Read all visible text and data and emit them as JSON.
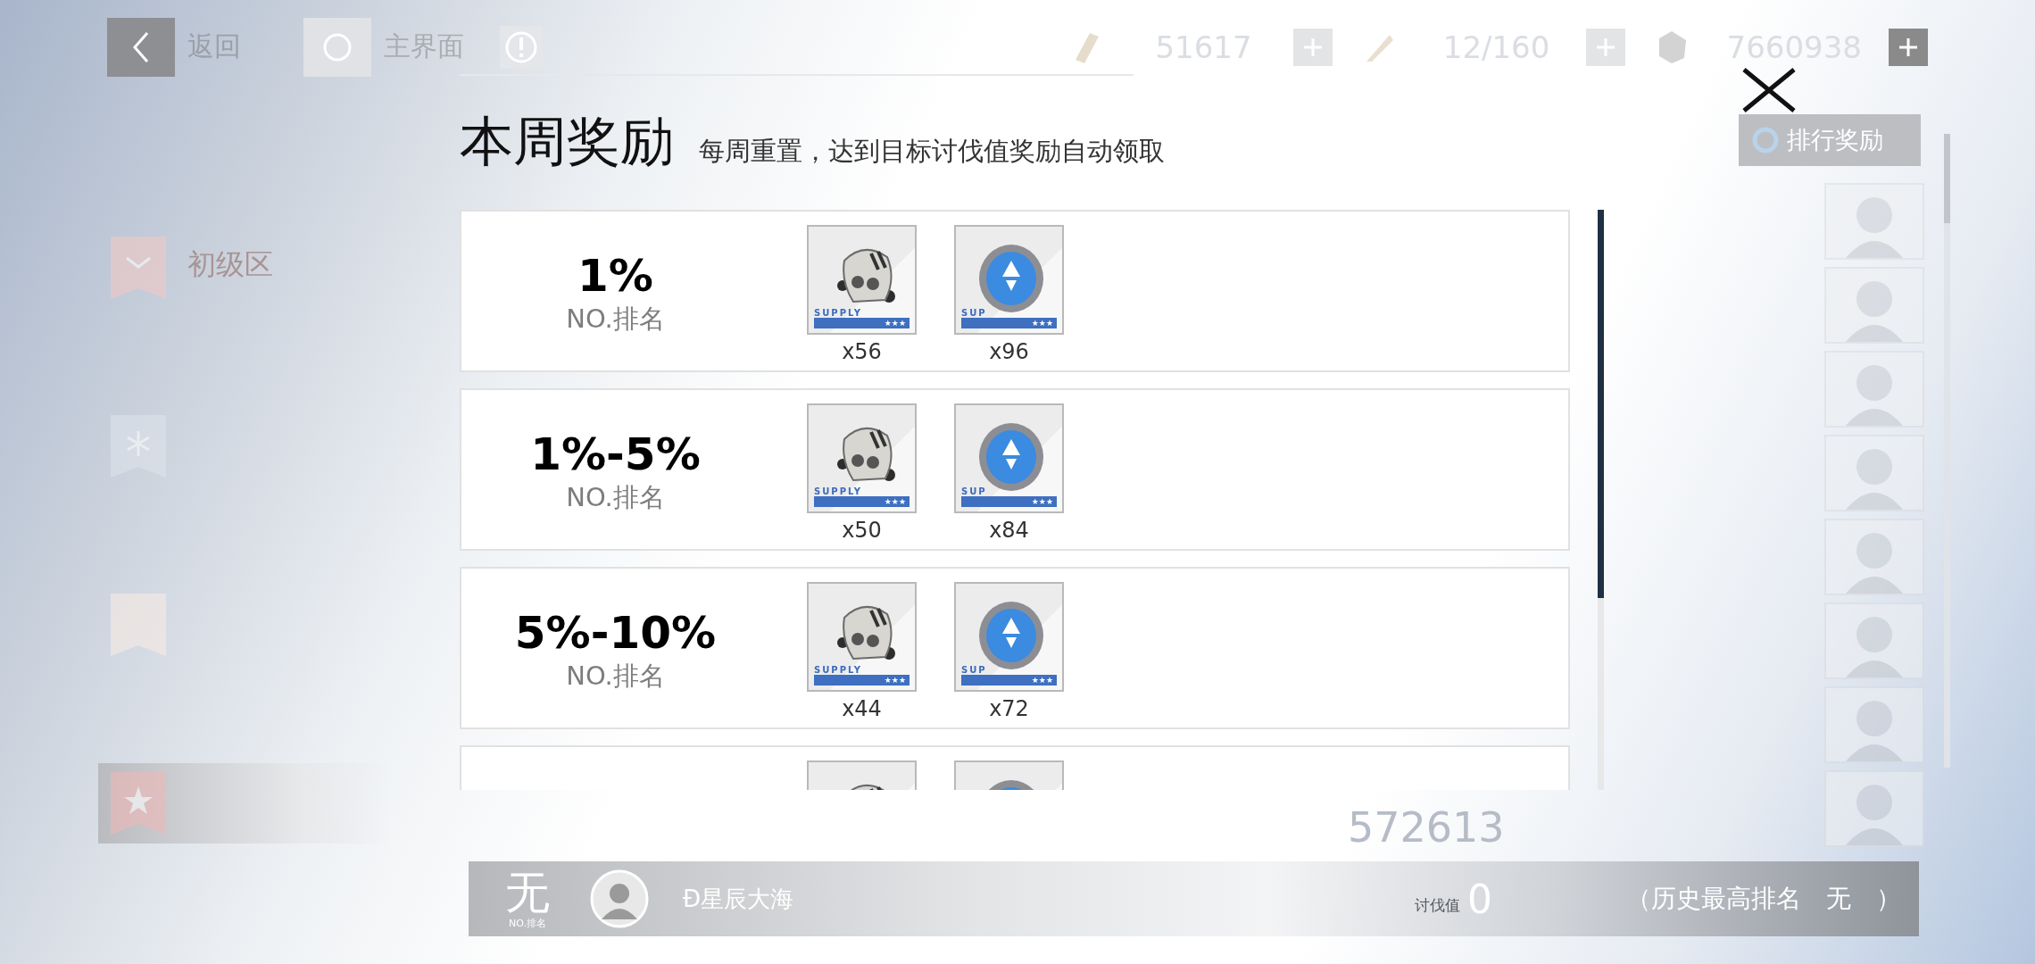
{
  "nav": {
    "back": "返回",
    "home": "主界面"
  },
  "currencies": [
    {
      "amount": "51617",
      "kind": "bar",
      "highlight": false
    },
    {
      "amount": "12/160",
      "kind": "feather",
      "highlight": false
    },
    {
      "amount": "7660938",
      "kind": "coin",
      "highlight": true
    }
  ],
  "sidebar": {
    "items": [
      {
        "kind": "chevron",
        "label": "初级区",
        "selected": false
      },
      {
        "kind": "snowflake",
        "selected": false
      },
      {
        "kind": "blank",
        "selected": false
      },
      {
        "kind": "star",
        "selected": true
      }
    ]
  },
  "background_score": "572613",
  "panel": {
    "title": "本周奖励",
    "subtitle": "每周重置，达到目标讨伐值奖励自动领取",
    "ranking_button": "排行奖励",
    "tiers": [
      {
        "tier": "1%",
        "caption": "NO.排名",
        "items": [
          {
            "kind": "mask",
            "tag": "SUPPLY",
            "rank": "★★★",
            "qty": "x56"
          },
          {
            "kind": "disc",
            "tag": "SUP",
            "rank": "★★★",
            "qty": "x96"
          }
        ]
      },
      {
        "tier": "1%-5%",
        "caption": "NO.排名",
        "items": [
          {
            "kind": "mask",
            "tag": "SUPPLY",
            "rank": "★★★",
            "qty": "x50"
          },
          {
            "kind": "disc",
            "tag": "SUP",
            "rank": "★★★",
            "qty": "x84"
          }
        ]
      },
      {
        "tier": "5%-10%",
        "caption": "NO.排名",
        "items": [
          {
            "kind": "mask",
            "tag": "SUPPLY",
            "rank": "★★★",
            "qty": "x44"
          },
          {
            "kind": "disc",
            "tag": "SUP",
            "rank": "★★★",
            "qty": "x72"
          }
        ]
      },
      {
        "items": [
          {
            "kind": "mask"
          },
          {
            "kind": "disc"
          }
        ]
      }
    ],
    "me": {
      "rank": "无",
      "rank_caption": "NO.排名",
      "name": "Ð星辰大海",
      "score_label": "讨伐值",
      "score": "0",
      "best": "（历史最高排名　无　）"
    }
  }
}
